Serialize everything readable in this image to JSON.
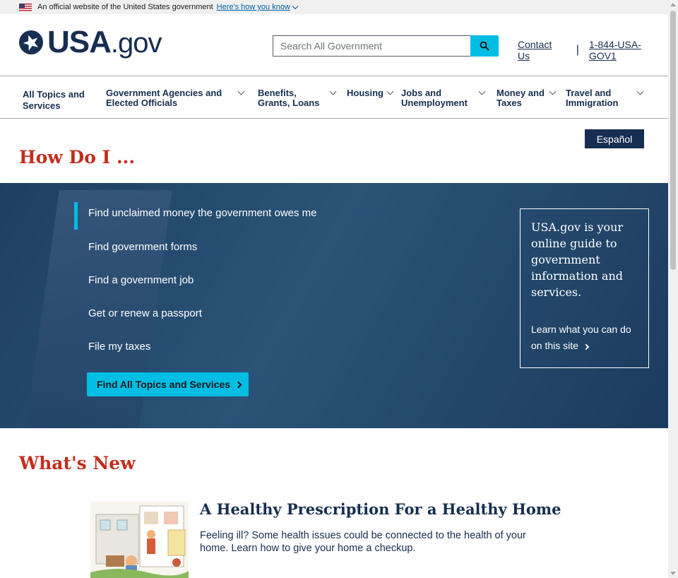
{
  "gov_banner": {
    "text": "An official website of the United States government",
    "link": "Here's how you know"
  },
  "header": {
    "logo_main": "USA",
    "logo_suffix": ".gov",
    "search_placeholder": "Search All Government",
    "contact": "Contact Us",
    "separator": "|",
    "phone": "1-844-USA-GOV1"
  },
  "nav": {
    "items": [
      {
        "label": "All Topics and Services"
      },
      {
        "label": "Government Agencies and Elected Officials"
      },
      {
        "label": "Benefits, Grants, Loans"
      },
      {
        "label": "Housing"
      },
      {
        "label": "Jobs and Unemployment"
      },
      {
        "label": "Money and Taxes"
      },
      {
        "label": "Travel and Immigration"
      }
    ]
  },
  "language_button": "Español",
  "how_do_i": {
    "title": "How Do I ...",
    "links": [
      "Find unclaimed money the government owes me",
      "Find government forms",
      "Find a government job",
      "Get or renew a passport",
      "File my taxes"
    ],
    "button": "Find All Topics and Services",
    "box_text": "USA.gov is your online guide to government information and services.",
    "box_link": "Learn what you can do on this site"
  },
  "whats_new": {
    "title": "What's New",
    "article_title": "A Healthy Prescription For a Healthy Home",
    "article_desc": "Feeling ill? Some health issues could be connected to the health of your home. Learn how to give your home a checkup."
  },
  "colors": {
    "navy": "#162e51",
    "cyan": "#00bde3",
    "red_heading": "#c32d1c"
  }
}
